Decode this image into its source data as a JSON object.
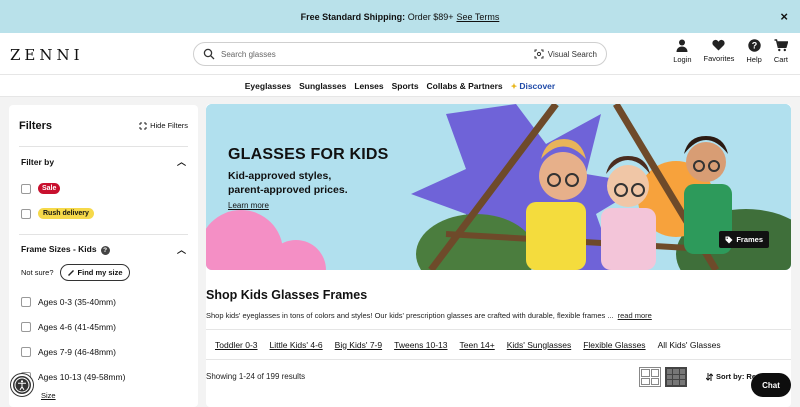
{
  "promo": {
    "bold": "Free Standard Shipping:",
    "text": "Order $89+",
    "link": "See Terms",
    "close": "×"
  },
  "header": {
    "logo": "ZENNI",
    "search_placeholder": "Search glasses",
    "visual_search": "Visual Search",
    "icons": [
      {
        "label": "Login",
        "icon": "user-icon"
      },
      {
        "label": "Favorites",
        "icon": "heart-icon"
      },
      {
        "label": "Help",
        "icon": "help-icon"
      },
      {
        "label": "Cart",
        "icon": "cart-icon"
      }
    ]
  },
  "nav": {
    "items": [
      "Eyeglasses",
      "Sunglasses",
      "Lenses",
      "Sports",
      "Collabs & Partners"
    ],
    "discover": "Discover"
  },
  "filters": {
    "title": "Filters",
    "hide": "Hide Filters",
    "filter_by": {
      "title": "Filter by",
      "options": [
        "Sale",
        "Rush delivery"
      ]
    },
    "frame_sizes": {
      "title": "Frame Sizes - Kids",
      "not_sure": "Not sure?",
      "find_size": "Find my size",
      "options": [
        "Ages 0-3 (35-40mm)",
        "Ages 4-6 (41-45mm)",
        "Ages 7-9 (46-48mm)",
        "Ages 10-13 (49-58mm)"
      ],
      "size_link": "Size"
    }
  },
  "hero": {
    "title": "GLASSES FOR KIDS",
    "line1": "Kid-approved styles,",
    "line2": "parent-approved prices.",
    "learn_more": "Learn more",
    "frames_badge": "Frames",
    "colors": {
      "sky": "#aee0ee",
      "purple": "#6f63d8",
      "pink": "#f48fc5",
      "orange": "#f7a23c"
    }
  },
  "shop": {
    "title": "Shop Kids Glasses Frames",
    "desc": "Shop kids' eyeglasses in tons of colors and styles! Our kids' prescription glasses are crafted with durable, flexible frames ...",
    "read_more": "read more",
    "categories": [
      "Toddler 0-3",
      "Little Kids' 4-6",
      "Big Kids' 7-9",
      "Tweens 10-13",
      "Teen 14+",
      "Kids' Sunglasses",
      "Flexible Glasses",
      "All Kids' Glasses"
    ],
    "showing": "Showing 1-24 of 199 results",
    "sort": "Sort by: Re"
  },
  "chat": "Chat"
}
